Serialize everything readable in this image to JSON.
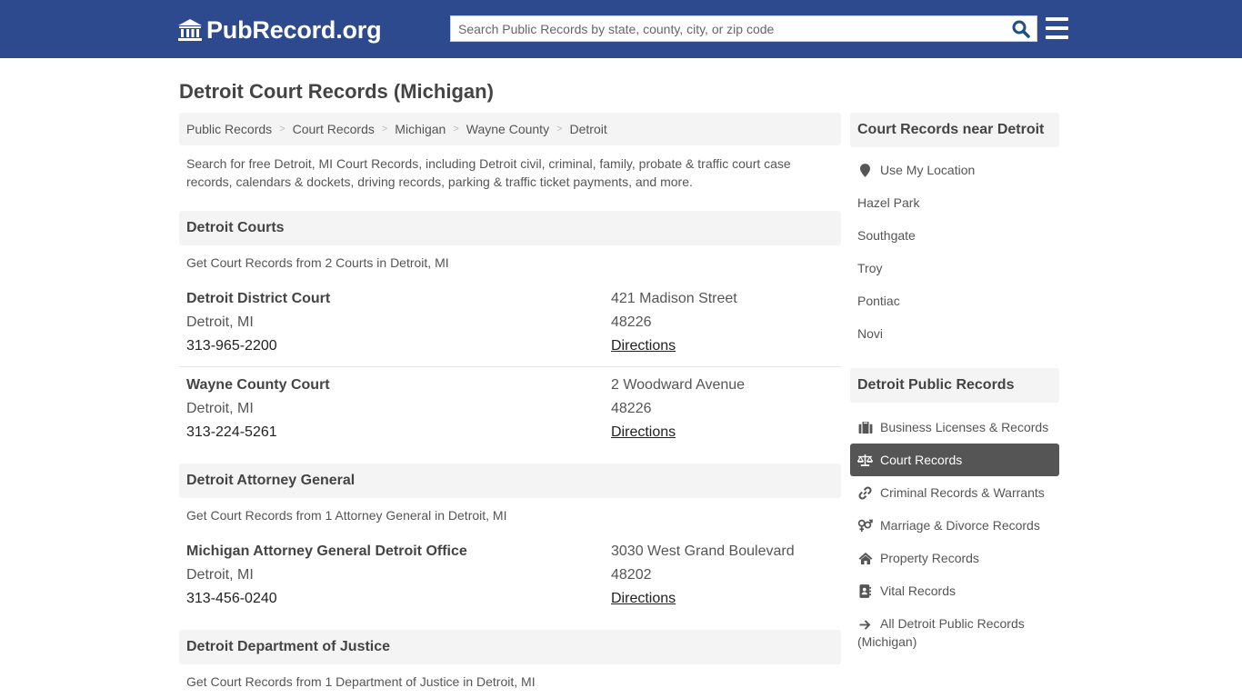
{
  "header": {
    "logo_text": "PubRecord.org",
    "search_placeholder": "Search Public Records by state, county, city, or zip code",
    "search_value": ""
  },
  "colors": {
    "header_bg": "#2e4a8f",
    "search_icon": "#1f4e8c",
    "active_item_bg": "#555555",
    "panel_bg": "#f4f4f4"
  },
  "page": {
    "title": "Detroit Court Records (Michigan)",
    "breadcrumb": [
      "Public Records",
      "Court Records",
      "Michigan",
      "Wayne County",
      "Detroit"
    ],
    "intro": "Search for free Detroit, MI Court Records, including Detroit civil, criminal, family, probate & traffic court case records, calendars & dockets, driving records, parking & traffic ticket payments, and more."
  },
  "sections": [
    {
      "title": "Detroit Courts",
      "subtitle": "Get Court Records from 2 Courts in Detroit, MI",
      "entries": [
        {
          "name": "Detroit District Court",
          "city": "Detroit, MI",
          "phone": "313-965-2200",
          "address": "421 Madison Street",
          "zip": "48226",
          "directions": "Directions"
        },
        {
          "name": "Wayne County Court",
          "city": "Detroit, MI",
          "phone": "313-224-5261",
          "address": "2 Woodward Avenue",
          "zip": "48226",
          "directions": "Directions"
        }
      ]
    },
    {
      "title": "Detroit Attorney General",
      "subtitle": "Get Court Records from 1 Attorney General in Detroit, MI",
      "entries": [
        {
          "name": "Michigan Attorney General Detroit Office",
          "city": "Detroit, MI",
          "phone": "313-456-0240",
          "address": "3030 West Grand Boulevard",
          "zip": "48202",
          "directions": "Directions"
        }
      ]
    },
    {
      "title": "Detroit Department of Justice",
      "subtitle": "Get Court Records from 1 Department of Justice in Detroit, MI",
      "entries": []
    }
  ],
  "sidebar": {
    "nearby": {
      "title": "Court Records near Detroit",
      "use_location": {
        "label": "Use My Location",
        "icon": "map-marker-icon"
      },
      "cities": [
        "Hazel Park",
        "Southgate",
        "Troy",
        "Pontiac",
        "Novi"
      ]
    },
    "public_records": {
      "title": "Detroit Public Records",
      "items": [
        {
          "label": "Business Licenses & Records",
          "icon": "briefcase-icon",
          "active": false
        },
        {
          "label": "Court Records",
          "icon": "balance-scale-icon",
          "active": true
        },
        {
          "label": "Criminal Records & Warrants",
          "icon": "link-icon",
          "active": false
        },
        {
          "label": "Marriage & Divorce Records",
          "icon": "venus-mars-icon",
          "active": false
        },
        {
          "label": "Property Records",
          "icon": "home-icon",
          "active": false
        },
        {
          "label": "Vital Records",
          "icon": "address-book-icon",
          "active": false
        },
        {
          "label": "All Detroit Public Records (Michigan)",
          "icon": "arrow-right-icon",
          "active": false
        }
      ]
    }
  }
}
